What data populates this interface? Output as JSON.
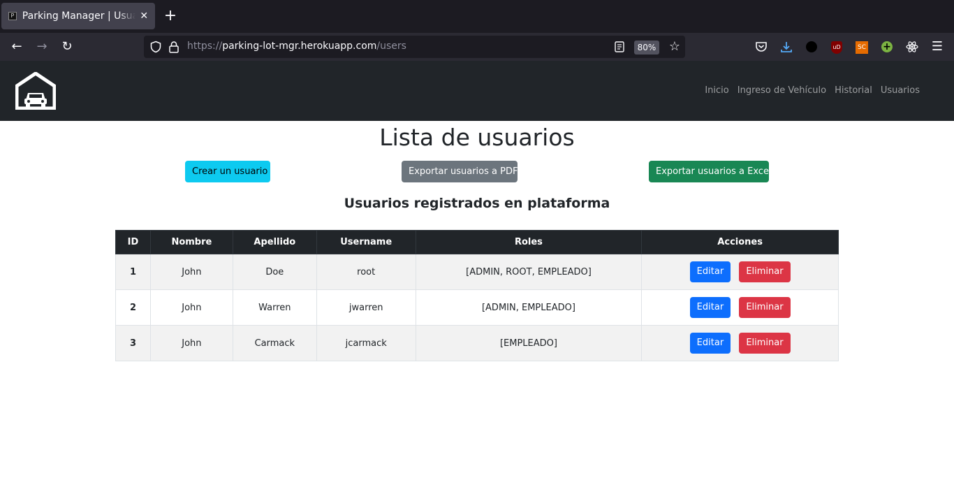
{
  "browser": {
    "tab_title": "Parking Manager | Usuarios",
    "tab_favicon": "P",
    "url_scheme": "https://",
    "url_host": "parking-lot-mgr.herokuapp.com",
    "url_path": "/users",
    "zoom": "80%",
    "extensions": [
      "pocket-icon",
      "download-icon",
      "dark-reader-icon",
      "ublock-icon",
      "sc-icon",
      "plus-icon",
      "react-icon",
      "menu-icon"
    ],
    "ext_labels": {
      "ublock": "uD",
      "sc": "SC"
    }
  },
  "nav": {
    "links": [
      "Inicio",
      "Ingreso de Vehículo",
      "Historial",
      "Usuarios"
    ]
  },
  "page": {
    "title": "Lista de usuarios",
    "create_button": "Crear un usuario",
    "export_pdf_button": "Exportar usuarios a PDF",
    "export_excel_button": "Exportar usuarios a Excel",
    "subtitle": "Usuarios registrados en plataforma"
  },
  "table": {
    "headers": [
      "ID",
      "Nombre",
      "Apellido",
      "Username",
      "Roles",
      "Acciones"
    ],
    "rows": [
      {
        "id": "1",
        "nombre": "John",
        "apellido": "Doe",
        "username": "root",
        "roles": "[ADMIN, ROOT, EMPLEADO]"
      },
      {
        "id": "2",
        "nombre": "John",
        "apellido": "Warren",
        "username": "jwarren",
        "roles": "[ADMIN, EMPLEADO]"
      },
      {
        "id": "3",
        "nombre": "John",
        "apellido": "Carmack",
        "username": "jcarmack",
        "roles": "[EMPLEADO]"
      }
    ],
    "edit_label": "Editar",
    "delete_label": "Eliminar"
  },
  "colors": {
    "navbar": "#212529",
    "info": "#0dcaf0",
    "secondary": "#6c757d",
    "success": "#198754",
    "primary": "#0d6efd",
    "danger": "#dc3545"
  }
}
